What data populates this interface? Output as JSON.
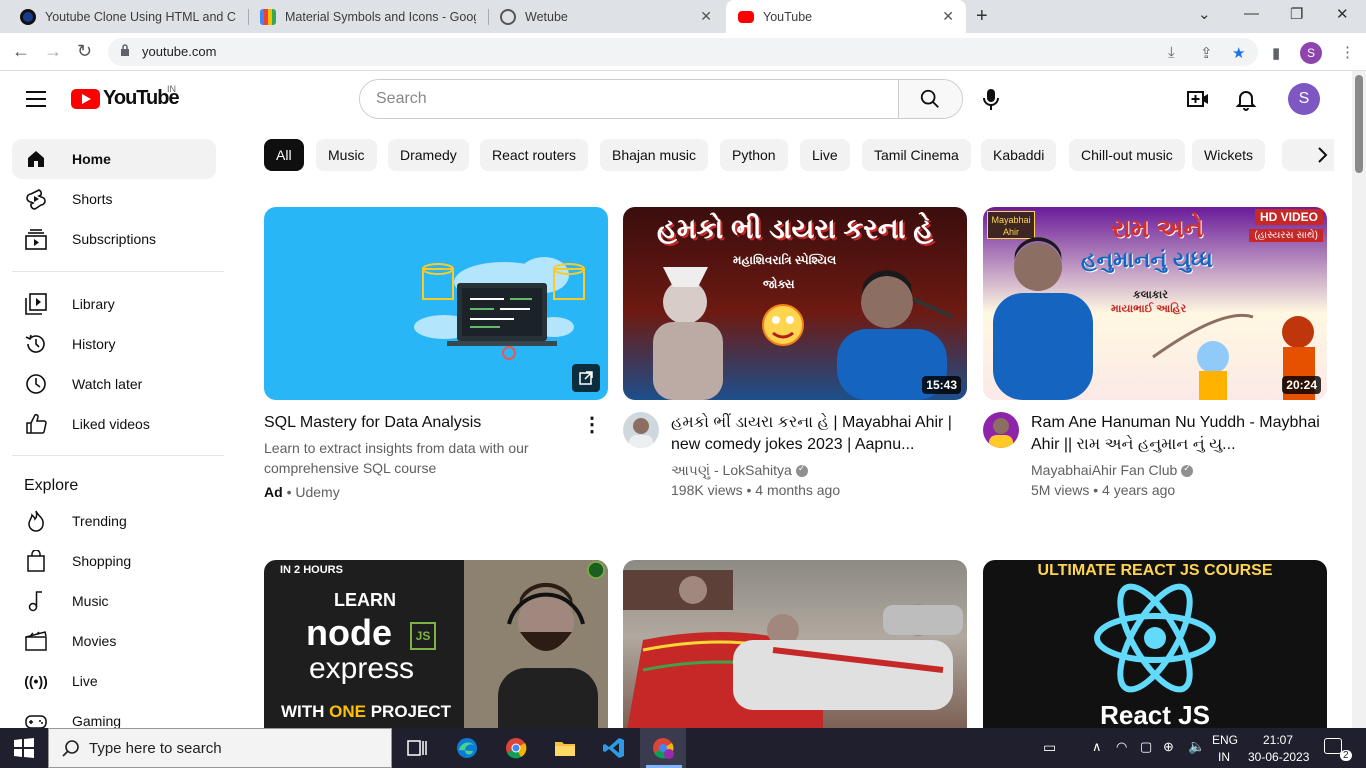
{
  "browser": {
    "tabs": [
      {
        "title": "Youtube Clone Using HTML and CSS",
        "active": false
      },
      {
        "title": "Material Symbols and Icons - Google Fonts",
        "active": false
      },
      {
        "title": "Wetube",
        "active": false
      },
      {
        "title": "YouTube",
        "active": true
      }
    ],
    "url": "youtube.com",
    "profile_initial": "S"
  },
  "header": {
    "logo_text": "YouTube",
    "country_code": "IN",
    "search_placeholder": "Search",
    "avatar_initial": "S"
  },
  "sidebar": {
    "main": [
      {
        "label": "Home",
        "icon": "home-icon",
        "active": true
      },
      {
        "label": "Shorts",
        "icon": "shorts-icon"
      },
      {
        "label": "Subscriptions",
        "icon": "subscriptions-icon"
      }
    ],
    "library": [
      {
        "label": "Library",
        "icon": "library-icon"
      },
      {
        "label": "History",
        "icon": "history-icon"
      },
      {
        "label": "Watch later",
        "icon": "watch-later-icon"
      },
      {
        "label": "Liked videos",
        "icon": "like-icon"
      }
    ],
    "explore_heading": "Explore",
    "explore": [
      {
        "label": "Trending",
        "icon": "trending-icon"
      },
      {
        "label": "Shopping",
        "icon": "shopping-icon"
      },
      {
        "label": "Music",
        "icon": "music-icon"
      },
      {
        "label": "Movies",
        "icon": "movies-icon"
      },
      {
        "label": "Live",
        "icon": "live-icon"
      },
      {
        "label": "Gaming",
        "icon": "gaming-icon"
      }
    ]
  },
  "chips": [
    "All",
    "Music",
    "Dramedy",
    "React routers",
    "Bhajan music",
    "Python",
    "Live",
    "Tamil Cinema",
    "Kabaddi",
    "Chill-out music",
    "Wickets"
  ],
  "videos": [
    {
      "title": "SQL Mastery for Data Analysis",
      "description": "Learn to extract insights from data with our comprehensive SQL course",
      "ad_label": "Ad",
      "advertiser": "Udemy",
      "is_ad": true
    },
    {
      "title": "હમકો ભીં ડાયરા કરના હે | Mayabhai Ahir | new comedy jokes 2023 | Aapnu...",
      "channel": "આપણું - LokSahitya",
      "stats": "198K views • 4 months ago",
      "duration": "15:43",
      "thumb_text_top": "હમકો ભી ડાયરા કરના હે",
      "thumb_text_sub": "મહાશિવરાત્રિ સ્પેશ્યિલ",
      "thumb_text_sub2": "જોક્સ"
    },
    {
      "title": "Ram Ane Hanuman Nu Yuddh - Maybhai Ahir || રામ અને હનુમાન નું યુ...",
      "channel": "MayabhaiAhir Fan Club",
      "stats": "5M views • 4 years ago",
      "duration": "20:24",
      "thumb_badge": "HD VIDEO",
      "thumb_badge2": "(હાસ્યરસ સાથે)",
      "thumb_text_top": "રામ અને",
      "thumb_text_mid": "હનુમાનનું યુધ્ધ",
      "thumb_text_sub": "કલાકાર",
      "thumb_text_sub2": "માયાભાઈ આહિર",
      "thumb_logo": "Mayabhai Ahir"
    },
    {
      "thumb_text_top": "IN 2 HOURS",
      "thumb_text_mid": "LEARN",
      "thumb_text_node": "node",
      "thumb_text_express": "express",
      "thumb_text_bottom_a": "WITH ",
      "thumb_text_bottom_b": "ONE",
      "thumb_text_bottom_c": " PROJECT"
    },
    {},
    {
      "thumb_text_top": "ULTIMATE REACT JS COURSE",
      "thumb_text_bottom": "React JS"
    }
  ],
  "taskbar": {
    "search_placeholder": "Type here to search",
    "lang": "ENG",
    "region": "IN",
    "time": "21:07",
    "date": "30-06-2023",
    "notif_count": "2"
  },
  "colors": {
    "brand_red": "#ff0000",
    "chip_active": "#0f0f0f",
    "avatar_purple": "#7e57c2"
  }
}
